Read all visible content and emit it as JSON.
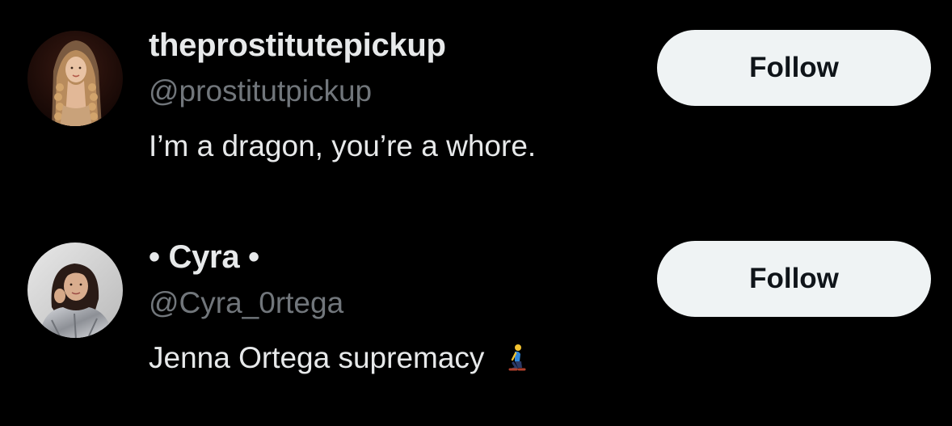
{
  "accounts": [
    {
      "display_name": "theprostitutepickup",
      "handle": "@prostitutpickup",
      "bio": "I’m a dragon, you’re a whore.",
      "follow_label": "Follow",
      "avatar_icon": "profile-photo-woman-long-curly-hair"
    },
    {
      "display_name": "• Cyra •",
      "handle": "@Cyra_0rtega",
      "bio": "Jenna Ortega supremacy",
      "bio_emoji": "person-kneeling-emoji",
      "follow_label": "Follow",
      "avatar_icon": "profile-photo-woman-dark-hair-silver-jacket"
    }
  ],
  "colors": {
    "background": "#000000",
    "primary_text": "#e7e9ea",
    "secondary_text": "#71767b",
    "button_bg": "#eff3f4",
    "button_text": "#0f1419"
  }
}
